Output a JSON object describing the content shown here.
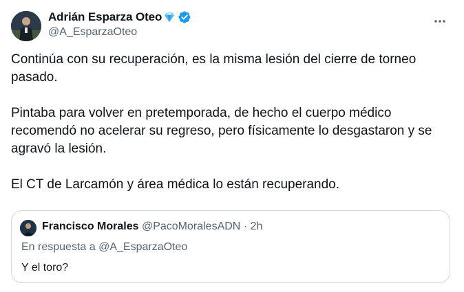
{
  "author": {
    "name": "Adrián Esparza Oteo",
    "handle": "@A_EsparzaOteo",
    "verified": true,
    "badge_emoji": "gem-stone"
  },
  "tweet": {
    "paragraphs": [
      "Continúa con su recuperación, es la misma lesión del cierre de torneo pasado.",
      "Pintaba para volver en pretemporada, de hecho el cuerpo médico recomendó no acelerar su regreso, pero físicamente lo desgastaron y se agravó la lesión.",
      "El CT de Larcamón y área médica lo están recuperando."
    ]
  },
  "quote": {
    "name": "Francisco Morales",
    "handle": "@PacoMoralesADN",
    "separator": "·",
    "time": "2h",
    "reply_prefix": "En respuesta a ",
    "reply_to": "@A_EsparzaOteo",
    "text": "Y el toro?"
  },
  "colors": {
    "text": "#0f1419",
    "secondary": "#536471",
    "verified": "#1d9bf0",
    "border": "#cfd9de"
  },
  "icons": {
    "more": "more-horizontal-icon",
    "verified": "verified-badge-icon"
  }
}
